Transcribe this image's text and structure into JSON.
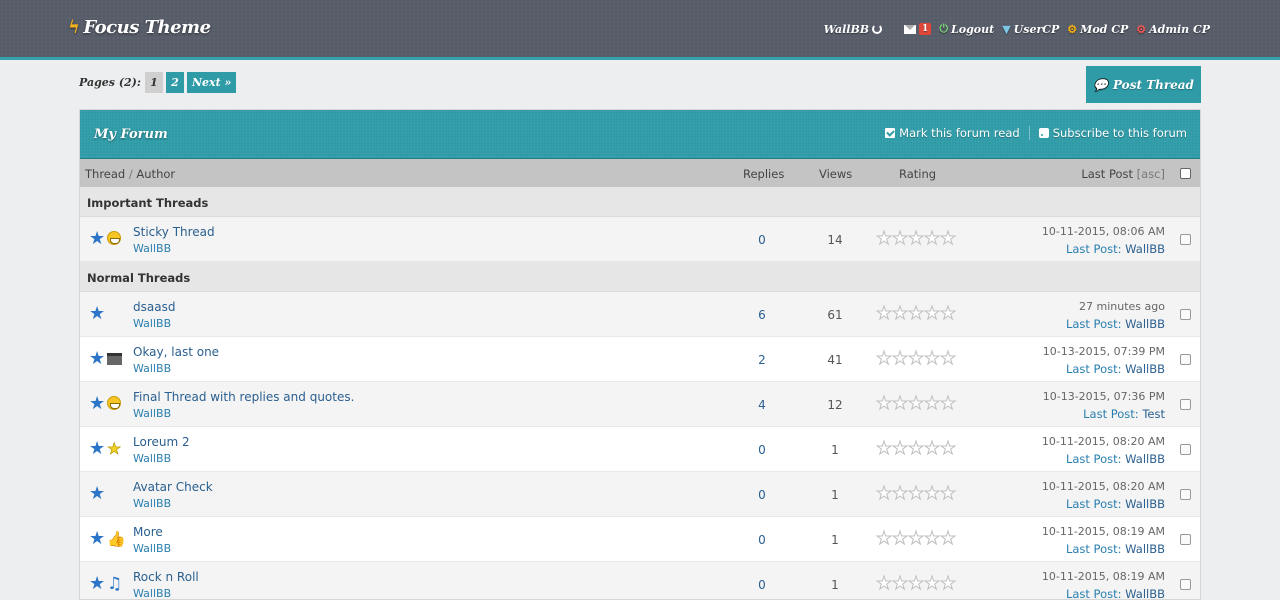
{
  "header": {
    "logo": "Focus Theme",
    "username": "WallBB",
    "messages_count": "1",
    "logout": "Logout",
    "usercp": "UserCP",
    "modcp": "Mod CP",
    "admincp": "Admin CP"
  },
  "pagination": {
    "label": "Pages (2):",
    "current": "1",
    "page2": "2",
    "next": "Next »"
  },
  "post_thread": "Post Thread",
  "forum": {
    "title": "My Forum",
    "mark_read": "Mark this forum read",
    "subscribe": "Subscribe to this forum",
    "columns": {
      "thread": "Thread",
      "slash": "/",
      "author": "Author",
      "replies": "Replies",
      "views": "Views",
      "rating": "Rating",
      "lastpost": "Last Post",
      "asc": "[asc]"
    },
    "sections": {
      "important": "Important Threads",
      "normal": "Normal Threads"
    },
    "last_post_label": "Last Post:",
    "rating_stars": 5,
    "threads": [
      {
        "subject": "Sticky Thread",
        "author": "WallBB",
        "replies": "0",
        "views": "14",
        "date": "10-11-2015, 08:06 AM",
        "last_by": "WallBB",
        "icon": "grin-icon"
      },
      {
        "subject": "dsaasd",
        "author": "WallBB",
        "replies": "6",
        "views": "61",
        "date": "27 minutes ago",
        "last_by": "WallBB",
        "icon": ""
      },
      {
        "subject": "Okay, last one",
        "author": "WallBB",
        "replies": "2",
        "views": "41",
        "date": "10-13-2015, 07:39 PM",
        "last_by": "WallBB",
        "icon": "clapperboard-icon"
      },
      {
        "subject": "Final Thread with replies and quotes.",
        "author": "WallBB",
        "replies": "4",
        "views": "12",
        "date": "10-13-2015, 07:36 PM",
        "last_by": "Test",
        "icon": "grin-icon"
      },
      {
        "subject": "Loreum 2",
        "author": "WallBB",
        "replies": "0",
        "views": "1",
        "date": "10-11-2015, 08:20 AM",
        "last_by": "WallBB",
        "icon": "yellow-star-icon"
      },
      {
        "subject": "Avatar Check",
        "author": "WallBB",
        "replies": "0",
        "views": "1",
        "date": "10-11-2015, 08:20 AM",
        "last_by": "WallBB",
        "icon": ""
      },
      {
        "subject": "More",
        "author": "WallBB",
        "replies": "0",
        "views": "1",
        "date": "10-11-2015, 08:19 AM",
        "last_by": "WallBB",
        "icon": "thumbs-up-icon"
      },
      {
        "subject": "Rock n Roll",
        "author": "WallBB",
        "replies": "0",
        "views": "1",
        "date": "10-11-2015, 08:19 AM",
        "last_by": "WallBB",
        "icon": "music-note-icon"
      }
    ]
  }
}
